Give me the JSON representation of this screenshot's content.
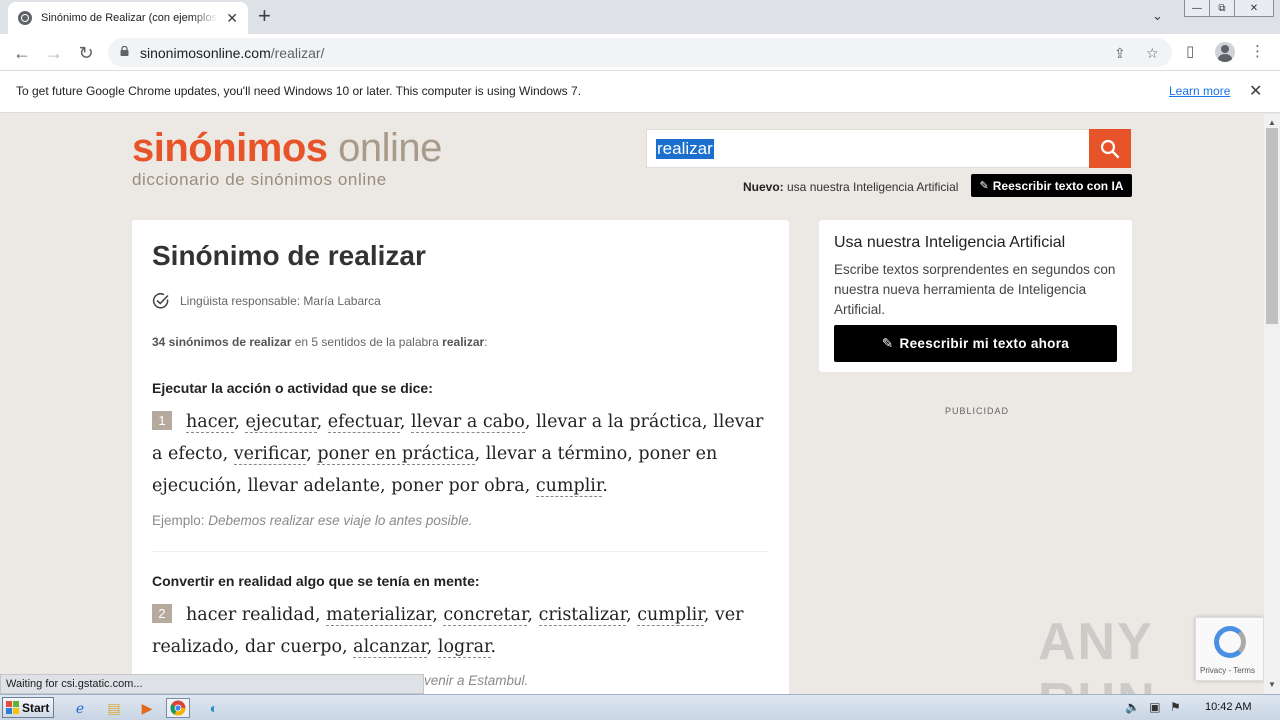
{
  "browser": {
    "tab_title": "Sinónimo de Realizar (con ejemplos y",
    "tab_close": "✕",
    "new_tab": "+",
    "url_host": "sinonimosonline.com",
    "url_path": "/realizar/",
    "window_min": "—",
    "window_restore": "⧉",
    "window_close": "✕"
  },
  "infobar": {
    "message": "To get future Google Chrome updates, you'll need Windows 10 or later. This computer is using Windows 7.",
    "learn_more": "Learn more",
    "close": "✕"
  },
  "site": {
    "logo_part1": "sinónimos",
    "logo_part2": " online",
    "tagline": "diccionario de sinónimos online",
    "search_value": "realizar",
    "nuevo_label": "Nuevo:",
    "nuevo_text": " usa nuestra Inteligencia Artificial",
    "ia_button": "Reescribir texto con IA"
  },
  "main": {
    "title": "Sinónimo de realizar",
    "linguist": "Lingüista responsable: María Labarca",
    "count_bold": "34 sinónimos de realizar",
    "count_mid": " en 5 sentidos de la palabra ",
    "count_word": "realizar",
    "count_end": ":",
    "senses": [
      {
        "title": "Ejecutar la acción o actividad que se dice:",
        "number": "1",
        "synonyms": [
          {
            "text": "hacer",
            "link": true
          },
          {
            "text": "ejecutar",
            "link": true
          },
          {
            "text": "efectuar",
            "link": true
          },
          {
            "text": "llevar a cabo",
            "link": true
          },
          {
            "text": "llevar a la práctica",
            "link": false
          },
          {
            "text": "llevar a efecto",
            "link": false
          },
          {
            "text": "verificar",
            "link": true
          },
          {
            "text": "poner en práctica",
            "link": true
          },
          {
            "text": "llevar a término",
            "link": false
          },
          {
            "text": "poner en ejecución",
            "link": false
          },
          {
            "text": "llevar adelante",
            "link": false
          },
          {
            "text": "poner por obra",
            "link": false
          },
          {
            "text": "cumplir",
            "link": true
          }
        ],
        "example_label": "Ejemplo: ",
        "example_text": "Debemos realizar ese viaje lo antes posible."
      },
      {
        "title": "Convertir en realidad algo que se tenía en mente:",
        "number": "2",
        "synonyms": [
          {
            "text": "hacer realidad",
            "link": false
          },
          {
            "text": "materializar",
            "link": true
          },
          {
            "text": "concretar",
            "link": true
          },
          {
            "text": "cristalizar",
            "link": true
          },
          {
            "text": "cumplir",
            "link": true
          },
          {
            "text": "ver realizado",
            "link": false
          },
          {
            "text": "dar cuerpo",
            "link": false
          },
          {
            "text": "alcanzar",
            "link": true
          },
          {
            "text": "lograr",
            "link": true
          }
        ],
        "example_partial": "venir a Estambul."
      }
    ]
  },
  "sidebar": {
    "title": "Usa nuestra Inteligencia Artificial",
    "text": "Escribe textos sorprendentes en segundos con nuestra nueva herramienta de Inteligencia Artificial.",
    "cta": "Reescribir mi texto ahora",
    "ad_label": "PUBLICIDAD"
  },
  "overlay": {
    "watermark": "ANY RUN",
    "recaptcha_terms": "Privacy - Terms",
    "status": "Waiting for csi.gstatic.com..."
  },
  "taskbar": {
    "start": "Start",
    "clock": "10:42 AM"
  },
  "colors": {
    "brand_orange": "#e8542a",
    "brand_taupe": "#a89b8c",
    "page_bg": "#ece8e3"
  }
}
